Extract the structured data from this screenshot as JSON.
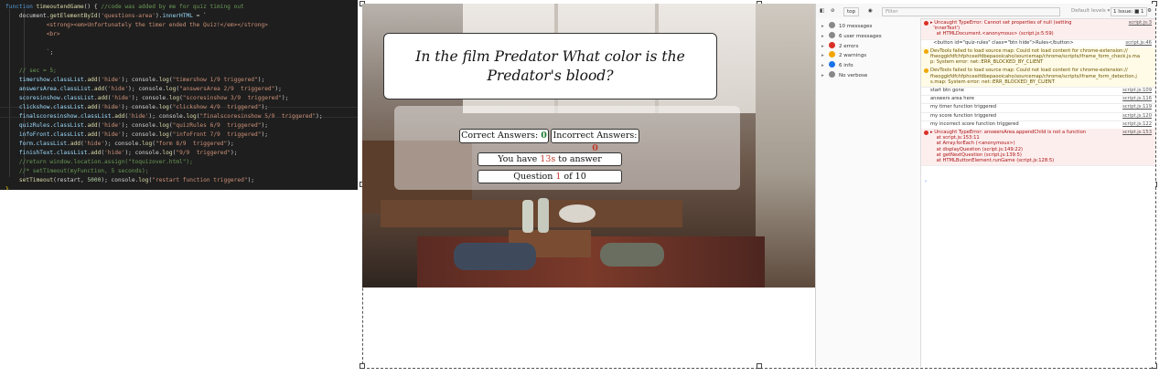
{
  "editor": {
    "lines": [
      [
        [
          "tk-kw",
          "function "
        ],
        [
          "tk-fn",
          "timeoutendGame"
        ],
        [
          "tk-p",
          "() { "
        ],
        [
          "tk-com",
          "//code was added by me for quiz timing out"
        ]
      ],
      [
        [
          "tk-p",
          "    document."
        ],
        [
          "tk-fn",
          "getElementById"
        ],
        [
          "tk-p",
          "("
        ],
        [
          "tk-str",
          "'questions-area'"
        ],
        [
          "tk-p",
          ")."
        ],
        [
          "tk-var",
          "innerHTML"
        ],
        [
          "tk-p",
          " = `"
        ]
      ],
      [
        [
          "tk-str",
          "            <strong><em>Unfortunately the timer ended the Quiz!</em></strong>"
        ]
      ],
      [
        [
          "tk-str",
          "            <br>"
        ]
      ],
      [
        [
          "tk-str",
          ""
        ]
      ],
      [
        [
          "tk-str",
          "            `"
        ],
        [
          "tk-p",
          ";"
        ]
      ],
      [
        [
          "tk-p",
          ""
        ]
      ],
      [
        [
          "tk-com",
          "    // sec = 5;"
        ]
      ],
      [
        [
          "tk-var",
          "    timershow"
        ],
        [
          "tk-p",
          "."
        ],
        [
          "tk-var",
          "classList"
        ],
        [
          "tk-p",
          "."
        ],
        [
          "tk-fn",
          "add"
        ],
        [
          "tk-p",
          "("
        ],
        [
          "tk-str",
          "'hide'"
        ],
        [
          "tk-p",
          "); console."
        ],
        [
          "tk-fn",
          "log"
        ],
        [
          "tk-p",
          "("
        ],
        [
          "tk-str",
          "\"timershow 1/9 triggered\""
        ],
        [
          "tk-p",
          ");"
        ]
      ],
      [
        [
          "tk-var",
          "    answersArea"
        ],
        [
          "tk-p",
          "."
        ],
        [
          "tk-var",
          "classList"
        ],
        [
          "tk-p",
          "."
        ],
        [
          "tk-fn",
          "add"
        ],
        [
          "tk-p",
          "("
        ],
        [
          "tk-str",
          "'hide'"
        ],
        [
          "tk-p",
          "); console."
        ],
        [
          "tk-fn",
          "log"
        ],
        [
          "tk-p",
          "("
        ],
        [
          "tk-str",
          "\"answersArea 2/9  triggered\""
        ],
        [
          "tk-p",
          ");"
        ]
      ],
      [
        [
          "tk-var",
          "    scoresinshow"
        ],
        [
          "tk-p",
          "."
        ],
        [
          "tk-var",
          "classList"
        ],
        [
          "tk-p",
          "."
        ],
        [
          "tk-fn",
          "add"
        ],
        [
          "tk-p",
          "("
        ],
        [
          "tk-str",
          "'hide'"
        ],
        [
          "tk-p",
          "); console."
        ],
        [
          "tk-fn",
          "log"
        ],
        [
          "tk-p",
          "("
        ],
        [
          "tk-str",
          "\"scoresinshow 3/9  triggered\""
        ],
        [
          "tk-p",
          ");"
        ]
      ],
      [
        [
          "tk-var",
          "    clickshow"
        ],
        [
          "tk-p",
          "."
        ],
        [
          "tk-var",
          "classList"
        ],
        [
          "tk-p",
          "."
        ],
        [
          "tk-fn",
          "add"
        ],
        [
          "tk-p",
          "("
        ],
        [
          "tk-str",
          "'hide'"
        ],
        [
          "tk-p",
          "); console."
        ],
        [
          "tk-fn",
          "log"
        ],
        [
          "tk-p",
          "("
        ],
        [
          "tk-str",
          "\"clickshow 4/9  triggered\""
        ],
        [
          "tk-p",
          ");"
        ]
      ],
      [
        [
          "tk-var",
          "    finalscoresinshow"
        ],
        [
          "tk-p",
          "."
        ],
        [
          "tk-var",
          "classList"
        ],
        [
          "tk-p",
          "."
        ],
        [
          "tk-fn",
          "add"
        ],
        [
          "tk-p",
          "("
        ],
        [
          "tk-str",
          "'hide'"
        ],
        [
          "tk-p",
          "); console."
        ],
        [
          "tk-fn",
          "log"
        ],
        [
          "tk-p",
          "("
        ],
        [
          "tk-str",
          "\"finalscoresinshow 5/9  triggered\""
        ],
        [
          "tk-p",
          ");"
        ]
      ],
      [
        [
          "tk-var",
          "    quizRules"
        ],
        [
          "tk-p",
          "."
        ],
        [
          "tk-var",
          "classList"
        ],
        [
          "tk-p",
          "."
        ],
        [
          "tk-fn",
          "add"
        ],
        [
          "tk-p",
          "("
        ],
        [
          "tk-str",
          "'hide'"
        ],
        [
          "tk-p",
          "); console."
        ],
        [
          "tk-fn",
          "log"
        ],
        [
          "tk-p",
          "("
        ],
        [
          "tk-str",
          "\"quizRules 6/9  triggered\""
        ],
        [
          "tk-p",
          ");"
        ]
      ],
      [
        [
          "tk-var",
          "    infoFront"
        ],
        [
          "tk-p",
          "."
        ],
        [
          "tk-var",
          "classList"
        ],
        [
          "tk-p",
          "."
        ],
        [
          "tk-fn",
          "add"
        ],
        [
          "tk-p",
          "("
        ],
        [
          "tk-str",
          "'hide'"
        ],
        [
          "tk-p",
          "); console."
        ],
        [
          "tk-fn",
          "log"
        ],
        [
          "tk-p",
          "("
        ],
        [
          "tk-str",
          "\"infoFront 7/9  triggered\""
        ],
        [
          "tk-p",
          ");"
        ]
      ],
      [
        [
          "tk-var",
          "    form"
        ],
        [
          "tk-p",
          "."
        ],
        [
          "tk-var",
          "classList"
        ],
        [
          "tk-p",
          "."
        ],
        [
          "tk-fn",
          "add"
        ],
        [
          "tk-p",
          "("
        ],
        [
          "tk-str",
          "'hide'"
        ],
        [
          "tk-p",
          "); console."
        ],
        [
          "tk-fn",
          "log"
        ],
        [
          "tk-p",
          "("
        ],
        [
          "tk-str",
          "\"form 8/9  triggered\""
        ],
        [
          "tk-p",
          ");"
        ]
      ],
      [
        [
          "tk-var",
          "    finishText"
        ],
        [
          "tk-p",
          "."
        ],
        [
          "tk-var",
          "classList"
        ],
        [
          "tk-p",
          "."
        ],
        [
          "tk-fn",
          "add"
        ],
        [
          "tk-p",
          "("
        ],
        [
          "tk-str",
          "'hide'"
        ],
        [
          "tk-p",
          "); console."
        ],
        [
          "tk-fn",
          "log"
        ],
        [
          "tk-p",
          "("
        ],
        [
          "tk-str",
          "\"9/9  triggered\""
        ],
        [
          "tk-p",
          ");"
        ]
      ],
      [
        [
          "tk-com",
          "    //return window.location.assign(\"toquizover.html\");"
        ]
      ],
      [
        [
          "tk-com",
          "    //* setTimeout(myFunction, 5 seconds);"
        ]
      ],
      [
        [
          "tk-p",
          "    "
        ],
        [
          "tk-fn",
          "setTimeout"
        ],
        [
          "tk-p",
          "(restart, "
        ],
        [
          "tk-num",
          "5000"
        ],
        [
          "tk-p",
          "); console."
        ],
        [
          "tk-fn",
          "log"
        ],
        [
          "tk-p",
          "("
        ],
        [
          "tk-str",
          "\"restart function triggered\""
        ],
        [
          "tk-p",
          ");"
        ]
      ],
      [
        [
          "tk-br",
          "}"
        ]
      ]
    ]
  },
  "quiz": {
    "question": "In the film Predator What color is the Predator's blood?",
    "correct_label": "Correct Answers:",
    "correct_value": "0",
    "incorrect_label": "Incorrect Answers:",
    "incorrect_value": "0",
    "timer_prefix": "You have ",
    "timer_value": "13s",
    "timer_suffix": " to answer",
    "question_prefix": "Question ",
    "question_current": "1",
    "question_suffix": " of 10"
  },
  "devtools": {
    "context": "top",
    "filter_placeholder": "Filter",
    "levels": "Default levels ▾",
    "issues": "1 Issue: ■ 1",
    "sidebar": [
      {
        "label": "10 messages",
        "color": "#888"
      },
      {
        "label": "6 user messages",
        "color": "#888"
      },
      {
        "label": "2 errors",
        "color": "#d93025"
      },
      {
        "label": "2 warnings",
        "color": "#f2a600"
      },
      {
        "label": "6 info",
        "color": "#1a73e8"
      },
      {
        "label": "No verbose",
        "color": "#888"
      }
    ],
    "messages": [
      {
        "kind": "err",
        "text": "▸ Uncaught TypeError: Cannot set properties of null (setting\n  'innerText')\n    at HTMLDocument.<anonymous> (script.js:5:59)",
        "src": "script.js:3"
      },
      {
        "kind": "plain",
        "text": "  <button id=\"quiz-rules\" class=\"btn hide\">Rules</button>",
        "src": "script.js:46"
      },
      {
        "kind": "warn",
        "text": "DevTools failed to load source map: Could not load content for chrome-extension://\nfheoggkfdfchfphceeifdbepaooicaho/sourcemap/chrome/scripts/iframe_form_check.js.ma\np: System error: net::ERR_BLOCKED_BY_CLIENT",
        "src": ""
      },
      {
        "kind": "warn",
        "text": "DevTools failed to load source map: Could not load content for chrome-extension://\nfheoggkfdfchfphceeifdbepaooicaho/sourcemap/chrome/scripts/iframe_form_detection.j\ns.map: System error: net::ERR_BLOCKED_BY_CLIENT",
        "src": ""
      },
      {
        "kind": "plain",
        "text": "start btn gone",
        "src": "script.js:109"
      },
      {
        "kind": "plain",
        "text": "answers area here",
        "src": "script.js:116"
      },
      {
        "kind": "plain",
        "text": "my timer function triggered",
        "src": "script.js:119"
      },
      {
        "kind": "plain",
        "text": "my score function triggered",
        "src": "script.js:120"
      },
      {
        "kind": "plain",
        "text": "my incorrect score function triggered",
        "src": "script.js:122"
      },
      {
        "kind": "err",
        "text": "▸ Uncaught TypeError: answersArea.appendChild is not a function\n    at script.js:153:11\n    at Array.forEach (<anonymous>)\n    at displayQuestion (script.js:149:22)\n    at getNextQuestion (script.js:139:5)\n    at HTMLButtonElement.runGame (script.js:128:5)",
        "src": "script.js:153"
      }
    ]
  }
}
